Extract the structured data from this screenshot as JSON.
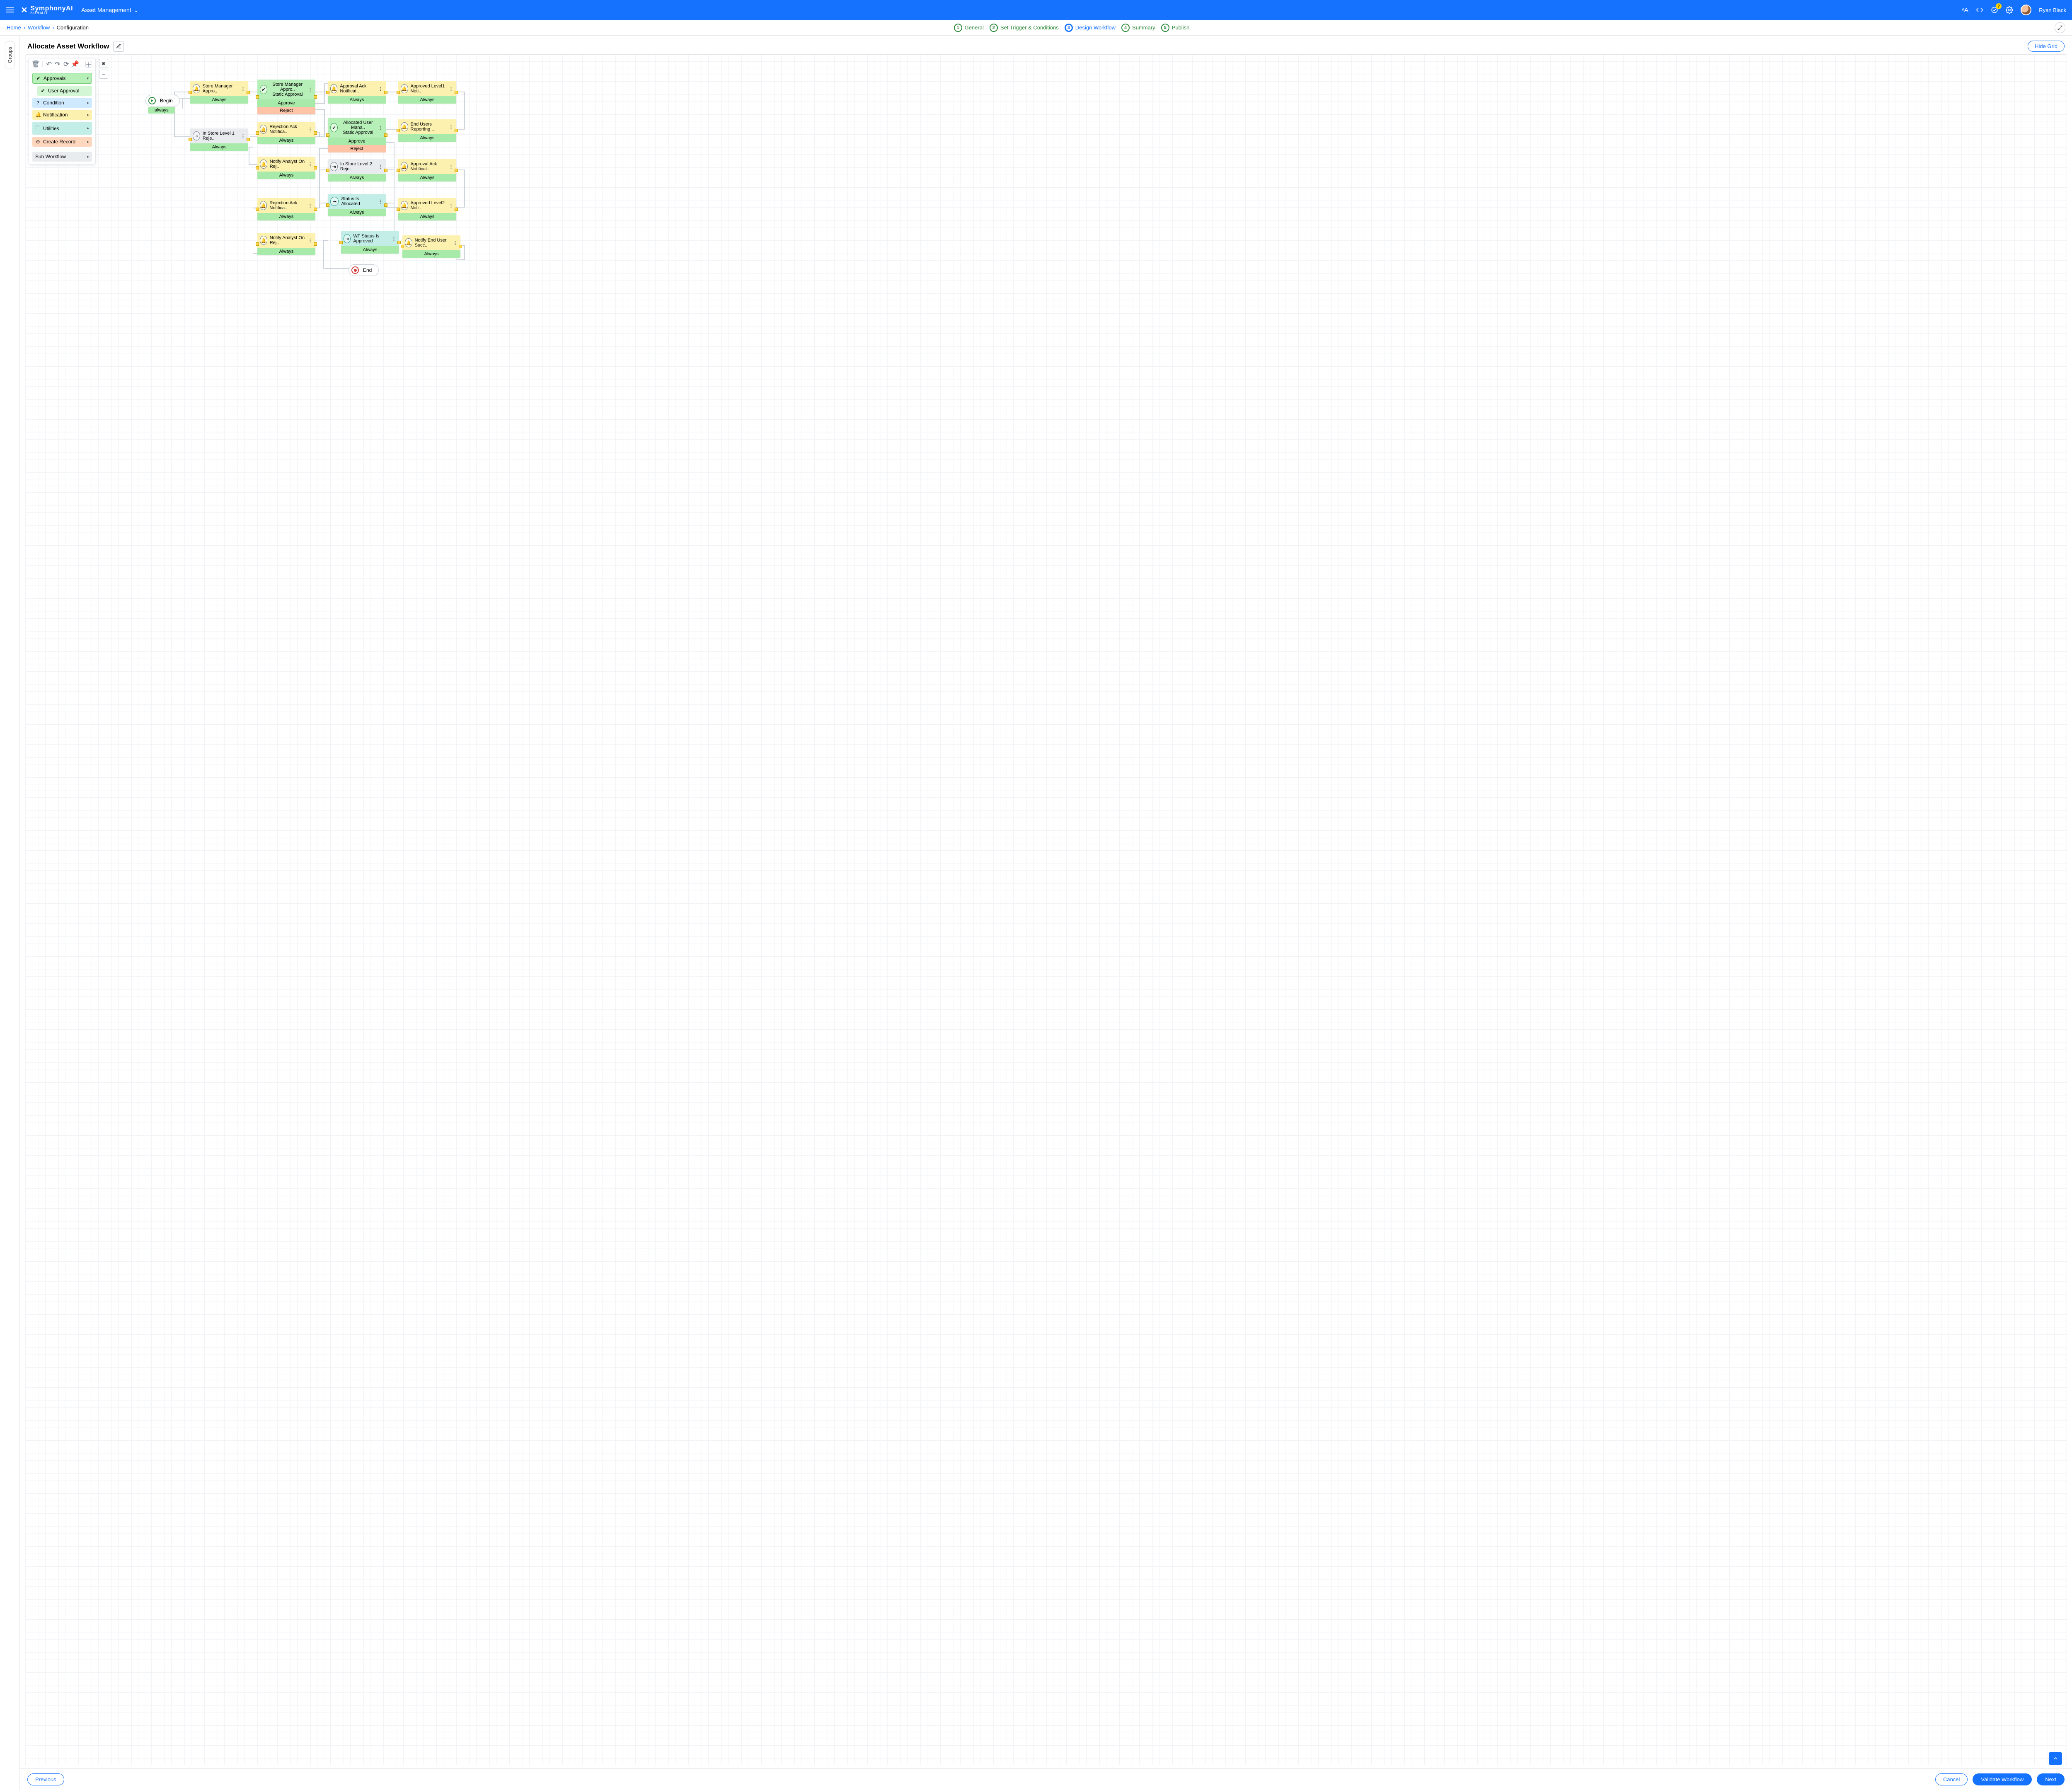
{
  "header": {
    "brand": "SymphonyAI",
    "brand_sub": "SUMMIT",
    "app_name": "Asset Management",
    "notifications_count": "7",
    "user_name": "Ryan Black",
    "font_size_icon": "AA"
  },
  "breadcrumbs": {
    "home": "Home",
    "workflow": "Workflow",
    "current": "Configuration"
  },
  "stepper": [
    {
      "num": "1",
      "label": "General"
    },
    {
      "num": "2",
      "label": "Set Trigger & Conditions"
    },
    {
      "num": "3",
      "label": "Design Workflow"
    },
    {
      "num": "4",
      "label": "Summary"
    },
    {
      "num": "5",
      "label": "Publish"
    }
  ],
  "groups_rail": "Groups",
  "title": "Allocate Asset Workflow",
  "hide_grid": "Hide Grid",
  "palette": {
    "approvals": "Approvals",
    "user_approval": "User Approval",
    "condition": "Condition",
    "notification": "Notification",
    "utilities": "Utilities",
    "create_record": "Create Record",
    "sub_workflow": "Sub Workflow"
  },
  "wf": {
    "begin": "Begin",
    "begin_always": "always",
    "end": "End",
    "always": "Always",
    "approve": "Approve",
    "reject": "Reject",
    "nodes": {
      "sm_appro1": "Store Manager Appro..",
      "sm_appro2_l1": "Store Manager Appro..",
      "sm_appro2_l2": "Static Approval",
      "ack1": "Approval Ack Notificat..",
      "lvl1": "Approved Level1 Noti..",
      "instore1": "In Store Level 1 Reje..",
      "rej_ack1": "Rejection Ack Notifica..",
      "alloc_user_l1": "Allocated User Mana..",
      "alloc_user_l2": "Static Approval",
      "end_users": "End Users Reporting ..",
      "notify_analyst1": "Notify Analyst On Rej..",
      "instore2": "In Store Level 2 Reje..",
      "ack2": "Approval Ack Notificat..",
      "rej_ack2": "Rejection Ack Notifica..",
      "status_alloc": "Status Is Allocated",
      "lvl2": "Approved Level2 Noti..",
      "notify_analyst2": "Notify Analyst On Rej..",
      "wf_approved": "WF Status Is Approved",
      "notify_end": "Notify End User Succ.."
    }
  },
  "footer": {
    "previous": "Previous",
    "cancel": "Cancel",
    "validate": "Validate Workflow",
    "next": "Next"
  }
}
